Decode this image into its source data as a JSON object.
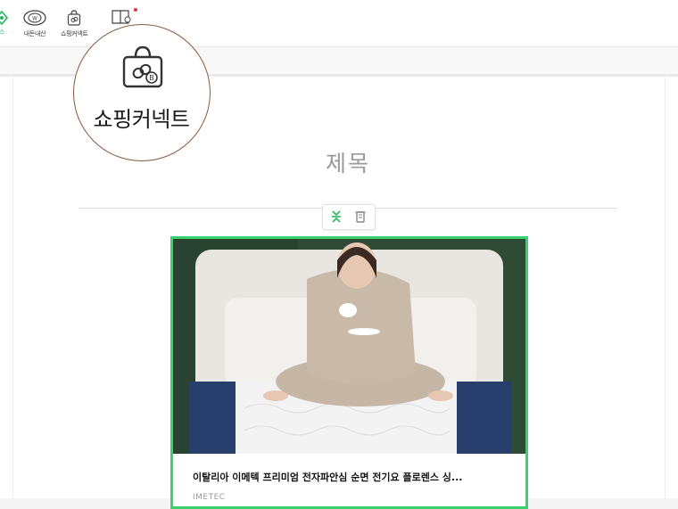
{
  "toolbar": {
    "items": [
      {
        "label": "스",
        "icon": "sticker-icon",
        "active": true
      },
      {
        "label": "내돈내산",
        "icon": "emoji-badge-icon"
      },
      {
        "label": "쇼핑커넥트",
        "icon": "shopping-bag-link-icon"
      },
      {
        "label": "",
        "icon": "book-icon",
        "has_new_dot": true
      }
    ]
  },
  "zoom_callout": {
    "label": "쇼핑커넥트",
    "icon": "shopping-bag-link-icon",
    "border_color": "#8a5a3c"
  },
  "editor": {
    "title": "제목",
    "mini_toolbar": {
      "align_icon": "align-center-icon",
      "delete_icon": "trash-icon"
    }
  },
  "product_card": {
    "name": "이탈리아 이메텍 프리미엄 전자파안심 순면 전기요 플로렌스 싱...",
    "brand": "IMETEC",
    "image": "product-photo",
    "border_color": "#3bd16f"
  },
  "colors": {
    "accent_green": "#25b85b",
    "new_dot": "#e0354a"
  }
}
